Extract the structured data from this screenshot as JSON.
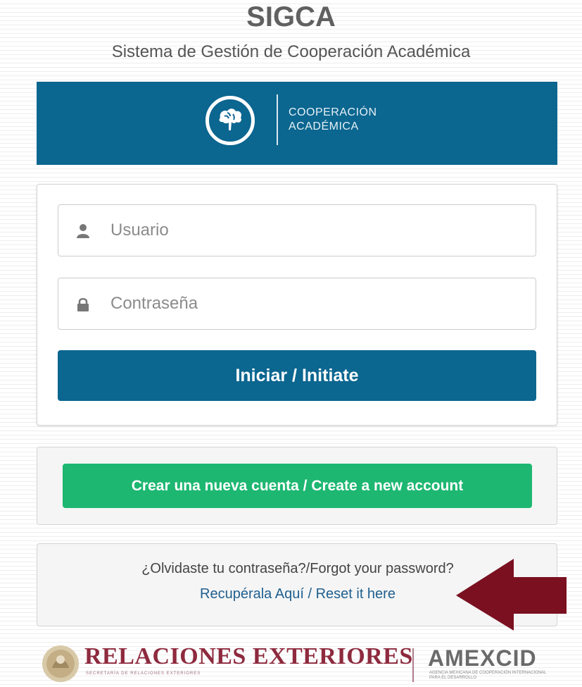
{
  "app": {
    "title": "SIGCA",
    "subtitle": "Sistema de Gestión de Cooperación Académica"
  },
  "banner": {
    "brand_line1": "COOPERACIÓN",
    "brand_line2": "ACADÉMICA",
    "logo_icon": "brain-tree-icon",
    "color": "#0b6690"
  },
  "login": {
    "username": {
      "value": "",
      "placeholder": "Usuario",
      "icon": "user-icon"
    },
    "password": {
      "value": "",
      "placeholder": "Contraseña",
      "icon": "lock-icon"
    },
    "submit_label": "Iniciar / Initiate"
  },
  "create": {
    "button_label": "Crear una nueva cuenta / Create a new account",
    "color": "#1db771"
  },
  "forgot": {
    "prompt": "¿Olvidaste tu contraseña?/Forgot your password?",
    "link_label": "Recupérala Aquí / Reset it here",
    "annotation_icon": "left-arrow-icon",
    "annotation_color": "#7a1020"
  },
  "footer": {
    "left_logo": "RELACIONES EXTERIORES",
    "left_sub": "SECRETARÍA DE RELACIONES EXTERIORES",
    "right_logo": "AMEXCID",
    "right_sub": "AGENCIA MEXICANA DE COOPERACIÓN INTERNACIONAL PARA EL DESARROLLO"
  }
}
